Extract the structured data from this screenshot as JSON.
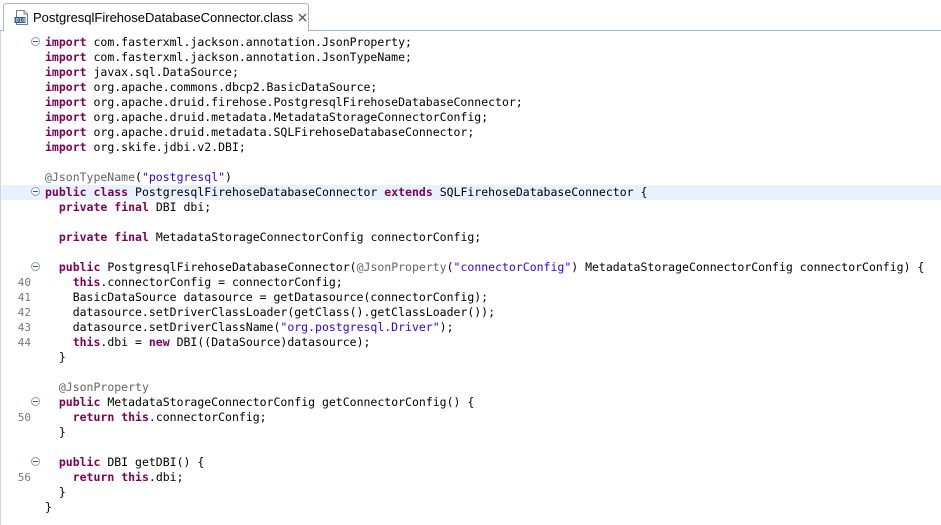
{
  "tab": {
    "title": "PostgresqlFirehoseDatabaseConnector.class",
    "icon": "class-file-icon",
    "close_icon": "close-icon"
  },
  "colors": {
    "keyword": "#7f0055",
    "string": "#2a00ff",
    "annotation": "#646464",
    "current_line": "#e8f2fe",
    "line_number": "#787878"
  },
  "editor": {
    "lines": [
      {
        "ln": "",
        "fold": true,
        "current": false,
        "tokens": [
          [
            "kw",
            "import"
          ],
          [
            "t",
            " com.fasterxml.jackson.annotation.JsonProperty;"
          ]
        ]
      },
      {
        "ln": "",
        "fold": false,
        "current": false,
        "tokens": [
          [
            "kw",
            "import"
          ],
          [
            "t",
            " com.fasterxml.jackson.annotation.JsonTypeName;"
          ]
        ]
      },
      {
        "ln": "",
        "fold": false,
        "current": false,
        "tokens": [
          [
            "kw",
            "import"
          ],
          [
            "t",
            " javax.sql.DataSource;"
          ]
        ]
      },
      {
        "ln": "",
        "fold": false,
        "current": false,
        "tokens": [
          [
            "kw",
            "import"
          ],
          [
            "t",
            " org.apache.commons.dbcp2.BasicDataSource;"
          ]
        ]
      },
      {
        "ln": "",
        "fold": false,
        "current": false,
        "tokens": [
          [
            "kw",
            "import"
          ],
          [
            "t",
            " org.apache.druid.firehose.PostgresqlFirehoseDatabaseConnector;"
          ]
        ]
      },
      {
        "ln": "",
        "fold": false,
        "current": false,
        "tokens": [
          [
            "kw",
            "import"
          ],
          [
            "t",
            " org.apache.druid.metadata.MetadataStorageConnectorConfig;"
          ]
        ]
      },
      {
        "ln": "",
        "fold": false,
        "current": false,
        "tokens": [
          [
            "kw",
            "import"
          ],
          [
            "t",
            " org.apache.druid.metadata.SQLFirehoseDatabaseConnector;"
          ]
        ]
      },
      {
        "ln": "",
        "fold": false,
        "current": false,
        "tokens": [
          [
            "kw",
            "import"
          ],
          [
            "t",
            " org.skife.jdbi.v2.DBI;"
          ]
        ]
      },
      {
        "ln": "",
        "fold": false,
        "current": false,
        "tokens": []
      },
      {
        "ln": "",
        "fold": false,
        "current": false,
        "tokens": [
          [
            "ann",
            "@JsonTypeName"
          ],
          [
            "t",
            "("
          ],
          [
            "str",
            "\"postgresql\""
          ],
          [
            "t",
            ")"
          ]
        ]
      },
      {
        "ln": "",
        "fold": true,
        "current": true,
        "tokens": [
          [
            "kw",
            "public"
          ],
          [
            "t",
            " "
          ],
          [
            "kw",
            "class"
          ],
          [
            "t",
            " PostgresqlFirehoseDatabaseConnector "
          ],
          [
            "kw",
            "extends"
          ],
          [
            "t",
            " SQLFirehoseDatabaseConnector {"
          ]
        ]
      },
      {
        "ln": "",
        "fold": false,
        "current": false,
        "tokens": [
          [
            "t",
            "  "
          ],
          [
            "kw",
            "private"
          ],
          [
            "t",
            " "
          ],
          [
            "kw",
            "final"
          ],
          [
            "t",
            " DBI dbi;"
          ]
        ]
      },
      {
        "ln": "",
        "fold": false,
        "current": false,
        "tokens": []
      },
      {
        "ln": "",
        "fold": false,
        "current": false,
        "tokens": [
          [
            "t",
            "  "
          ],
          [
            "kw",
            "private"
          ],
          [
            "t",
            " "
          ],
          [
            "kw",
            "final"
          ],
          [
            "t",
            " MetadataStorageConnectorConfig connectorConfig;"
          ]
        ]
      },
      {
        "ln": "",
        "fold": false,
        "current": false,
        "tokens": []
      },
      {
        "ln": "",
        "fold": true,
        "current": false,
        "tokens": [
          [
            "t",
            "  "
          ],
          [
            "kw",
            "public"
          ],
          [
            "t",
            " PostgresqlFirehoseDatabaseConnector("
          ],
          [
            "ann",
            "@JsonProperty"
          ],
          [
            "t",
            "("
          ],
          [
            "str",
            "\"connectorConfig\""
          ],
          [
            "t",
            ") MetadataStorageConnectorConfig connectorConfig) {"
          ]
        ]
      },
      {
        "ln": "40",
        "fold": false,
        "current": false,
        "tokens": [
          [
            "t",
            "    "
          ],
          [
            "kw",
            "this"
          ],
          [
            "t",
            ".connectorConfig = connectorConfig;"
          ]
        ]
      },
      {
        "ln": "41",
        "fold": false,
        "current": false,
        "tokens": [
          [
            "t",
            "    BasicDataSource datasource = getDatasource(connectorConfig);"
          ]
        ]
      },
      {
        "ln": "42",
        "fold": false,
        "current": false,
        "tokens": [
          [
            "t",
            "    datasource.setDriverClassLoader(getClass().getClassLoader());"
          ]
        ]
      },
      {
        "ln": "43",
        "fold": false,
        "current": false,
        "tokens": [
          [
            "t",
            "    datasource.setDriverClassName("
          ],
          [
            "str",
            "\"org.postgresql.Driver\""
          ],
          [
            "t",
            ");"
          ]
        ]
      },
      {
        "ln": "44",
        "fold": false,
        "current": false,
        "tokens": [
          [
            "t",
            "    "
          ],
          [
            "kw",
            "this"
          ],
          [
            "t",
            ".dbi = "
          ],
          [
            "kw",
            "new"
          ],
          [
            "t",
            " DBI((DataSource)datasource);"
          ]
        ]
      },
      {
        "ln": "",
        "fold": false,
        "current": false,
        "tokens": [
          [
            "t",
            "  }"
          ]
        ]
      },
      {
        "ln": "",
        "fold": false,
        "current": false,
        "tokens": []
      },
      {
        "ln": "",
        "fold": false,
        "current": false,
        "tokens": [
          [
            "t",
            "  "
          ],
          [
            "ann",
            "@JsonProperty"
          ]
        ]
      },
      {
        "ln": "",
        "fold": true,
        "current": false,
        "tokens": [
          [
            "t",
            "  "
          ],
          [
            "kw",
            "public"
          ],
          [
            "t",
            " MetadataStorageConnectorConfig getConnectorConfig() {"
          ]
        ]
      },
      {
        "ln": "50",
        "fold": false,
        "current": false,
        "tokens": [
          [
            "t",
            "    "
          ],
          [
            "kw",
            "return"
          ],
          [
            "t",
            " "
          ],
          [
            "kw",
            "this"
          ],
          [
            "t",
            ".connectorConfig;"
          ]
        ]
      },
      {
        "ln": "",
        "fold": false,
        "current": false,
        "tokens": [
          [
            "t",
            "  }"
          ]
        ]
      },
      {
        "ln": "",
        "fold": false,
        "current": false,
        "tokens": []
      },
      {
        "ln": "",
        "fold": true,
        "current": false,
        "tokens": [
          [
            "t",
            "  "
          ],
          [
            "kw",
            "public"
          ],
          [
            "t",
            " DBI getDBI() {"
          ]
        ]
      },
      {
        "ln": "56",
        "fold": false,
        "current": false,
        "tokens": [
          [
            "t",
            "    "
          ],
          [
            "kw",
            "return"
          ],
          [
            "t",
            " "
          ],
          [
            "kw",
            "this"
          ],
          [
            "t",
            ".dbi;"
          ]
        ]
      },
      {
        "ln": "",
        "fold": false,
        "current": false,
        "tokens": [
          [
            "t",
            "  }"
          ]
        ]
      },
      {
        "ln": "",
        "fold": false,
        "current": false,
        "tokens": [
          [
            "t",
            "}"
          ]
        ]
      }
    ]
  }
}
